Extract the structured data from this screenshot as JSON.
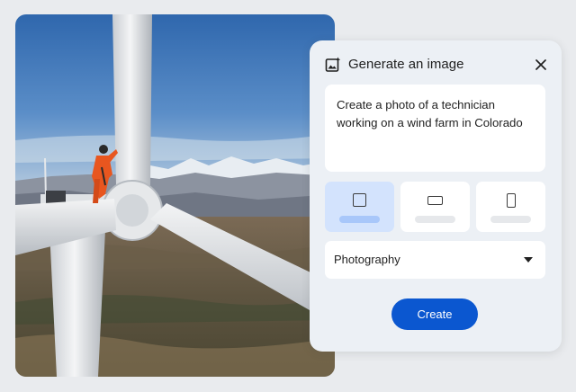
{
  "dialog": {
    "title": "Generate an image",
    "prompt_text": "Create a photo of a technician working on a wind farm in Colorado",
    "aspect_options": [
      {
        "name": "square",
        "selected": true
      },
      {
        "name": "landscape",
        "selected": false
      },
      {
        "name": "portrait",
        "selected": false
      }
    ],
    "style_value": "Photography",
    "create_label": "Create",
    "icons": {
      "header": "image-sparkle-icon",
      "close": "close-icon",
      "dropdown": "caret-down-icon"
    },
    "colors": {
      "panel_bg": "#ecf0f5",
      "selected_option": "#d3e3fd",
      "create_button": "#0b57d0"
    }
  }
}
